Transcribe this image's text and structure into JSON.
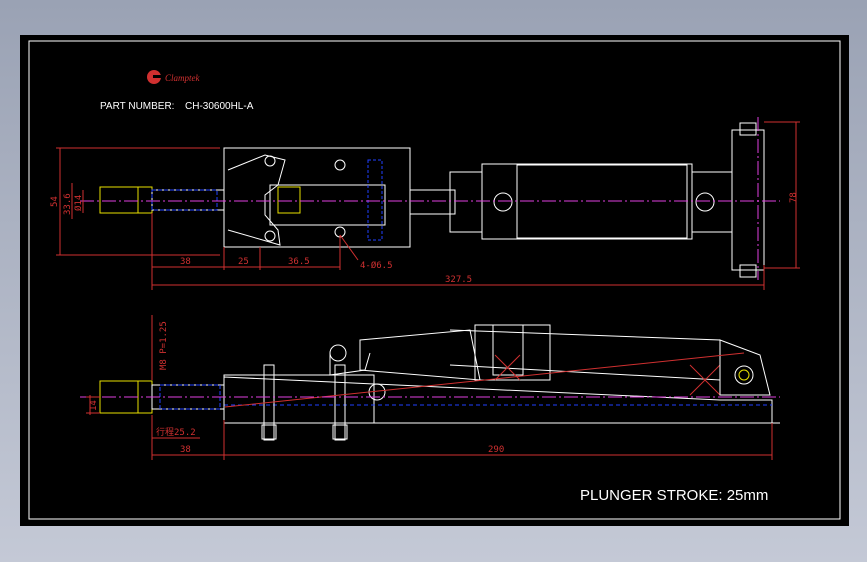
{
  "brand": {
    "name": "Clamptek"
  },
  "part": {
    "label": "PART NUMBER:",
    "number": "CH-30600HL-A"
  },
  "stroke_note": "PLUNGER STROKE: 25mm",
  "top_view": {
    "dims_horizontal": [
      "38",
      "25",
      "36.5",
      "327.5"
    ],
    "dims_vertical": [
      "54",
      "33.6",
      "Ø14",
      "78"
    ],
    "hole_note": "4-Ø6.5"
  },
  "side_view": {
    "thread": "M8 P=1.25",
    "height": "14",
    "stroke_cn": "行程25.2",
    "dims_horizontal": [
      "38",
      "290"
    ]
  },
  "colors": {
    "outline": "#ffffff",
    "dimension": "#d03030",
    "centerline": "#e040e0",
    "hidden": "#2040ff",
    "yellow": "#e8e000",
    "cyan": "#00c0c0"
  }
}
